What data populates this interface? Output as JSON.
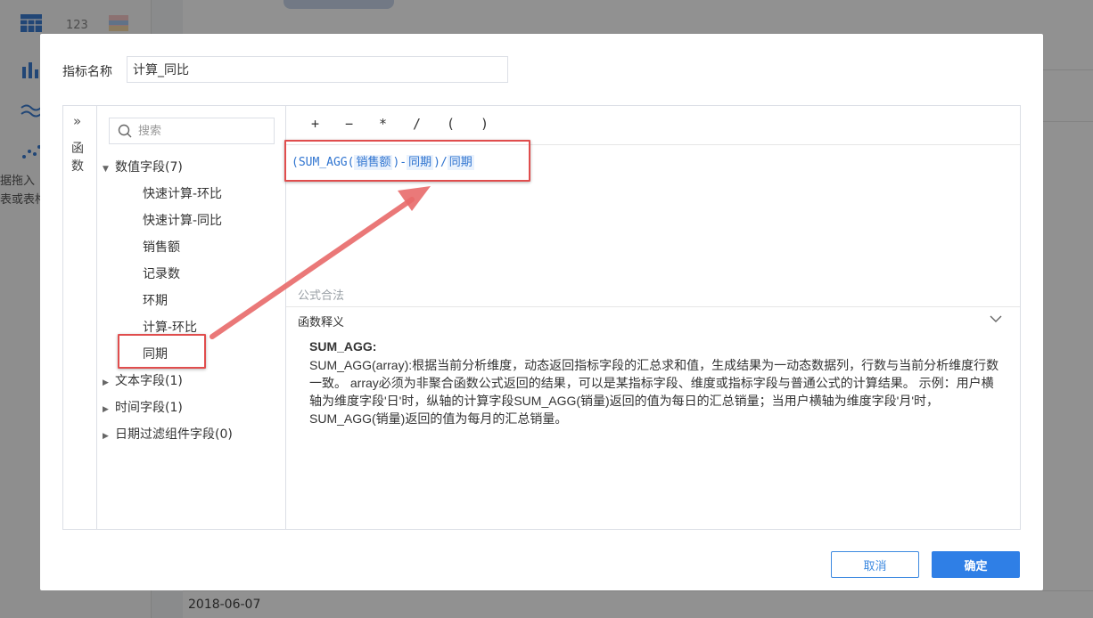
{
  "background": {
    "date_label": "2018-06-07",
    "left_hint_1": "据拖入",
    "left_hint_2": "表或表格"
  },
  "dialog": {
    "name_label": "指标名称",
    "name_value": "计算_同比"
  },
  "func_panel": {
    "label": "函数"
  },
  "search": {
    "placeholder": "搜索"
  },
  "fields": {
    "numeric_group": "数值字段(7)",
    "numeric_items": [
      "快速计算-环比",
      "快速计算-同比",
      "销售额",
      "记录数",
      "环期",
      "计算-环比",
      "同期"
    ],
    "text_group": "文本字段(1)",
    "time_group": "时间字段(1)",
    "date_filter_group": "日期过滤组件字段(0)"
  },
  "operators": [
    "+",
    "−",
    "*",
    "/",
    "(",
    ")"
  ],
  "formula": {
    "open": "(SUM_AGG(",
    "field_sales": "销售额",
    "minus": ")-",
    "field_same_period_1": "同期",
    "close_div": ")/",
    "field_same_period_2": "同期"
  },
  "status": {
    "legal": "公式合法"
  },
  "explain": {
    "title": "函数释义",
    "func_name": "SUM_AGG:",
    "body": "SUM_AGG(array):根据当前分析维度，动态返回指标字段的汇总求和值，生成结果为一动态数据列，行数与当前分析维度行数一致。 array必须为非聚合函数公式返回的结果，可以是某指标字段、维度或指标字段与普通公式的计算结果。 示例：用户横轴为维度字段'日'时，纵轴的计算字段SUM_AGG(销量)返回的值为每日的汇总销量；当用户横轴为维度字段'月'时，SUM_AGG(销量)返回的值为每月的汇总销量。"
  },
  "buttons": {
    "cancel": "取消",
    "ok": "确定"
  },
  "colors": {
    "primary": "#2f7fe6",
    "annotation": "#e04d4d",
    "formula_text": "#2f74d0"
  }
}
